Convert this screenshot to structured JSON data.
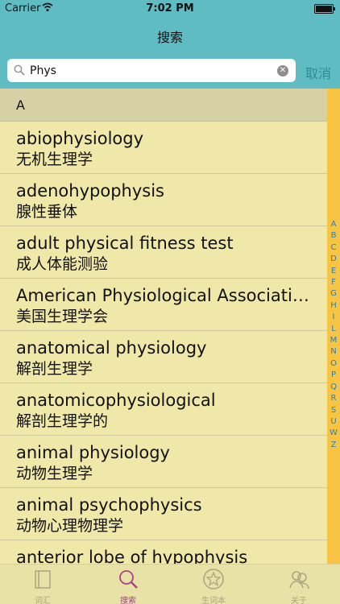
{
  "status_bar": {
    "carrier": "Carrier",
    "time": "7:02 PM"
  },
  "nav": {
    "title": "搜索"
  },
  "search": {
    "value": "Phys",
    "cancel_label": "取消"
  },
  "section": {
    "header": "A"
  },
  "entries": [
    {
      "en": "abiophysiology",
      "zh": "无机生理学"
    },
    {
      "en": "adenohypophysis",
      "zh": "腺性垂体"
    },
    {
      "en": "adult physical fitness test",
      "zh": "成人体能测验"
    },
    {
      "en": "American Physiological Associati…",
      "zh": "美国生理学会"
    },
    {
      "en": "anatomical physiology",
      "zh": "解剖生理学"
    },
    {
      "en": "anatomicophysiological",
      "zh": "解剖生理学的"
    },
    {
      "en": "animal physiology",
      "zh": "动物生理学"
    },
    {
      "en": "animal psychophysics",
      "zh": "动物心理物理学"
    },
    {
      "en": "anterior lobe of hypophysis",
      "zh": ""
    }
  ],
  "index_letters": [
    "A",
    "B",
    "C",
    "D",
    "E",
    "F",
    "G",
    "H",
    "I",
    "L",
    "M",
    "N",
    "O",
    "P",
    "Q",
    "R",
    "S",
    "U",
    "W",
    "Z"
  ],
  "tabs": [
    {
      "label": "词汇",
      "icon": "book-icon"
    },
    {
      "label": "搜索",
      "icon": "search-icon"
    },
    {
      "label": "生词本",
      "icon": "star-icon"
    },
    {
      "label": "关于",
      "icon": "people-icon"
    }
  ],
  "colors": {
    "header": "#5fbcc2",
    "list_bg": "#efe8a8",
    "index_bar": "#f7c443",
    "active_tab": "#a64488",
    "cancel_text": "#2f8c97"
  }
}
